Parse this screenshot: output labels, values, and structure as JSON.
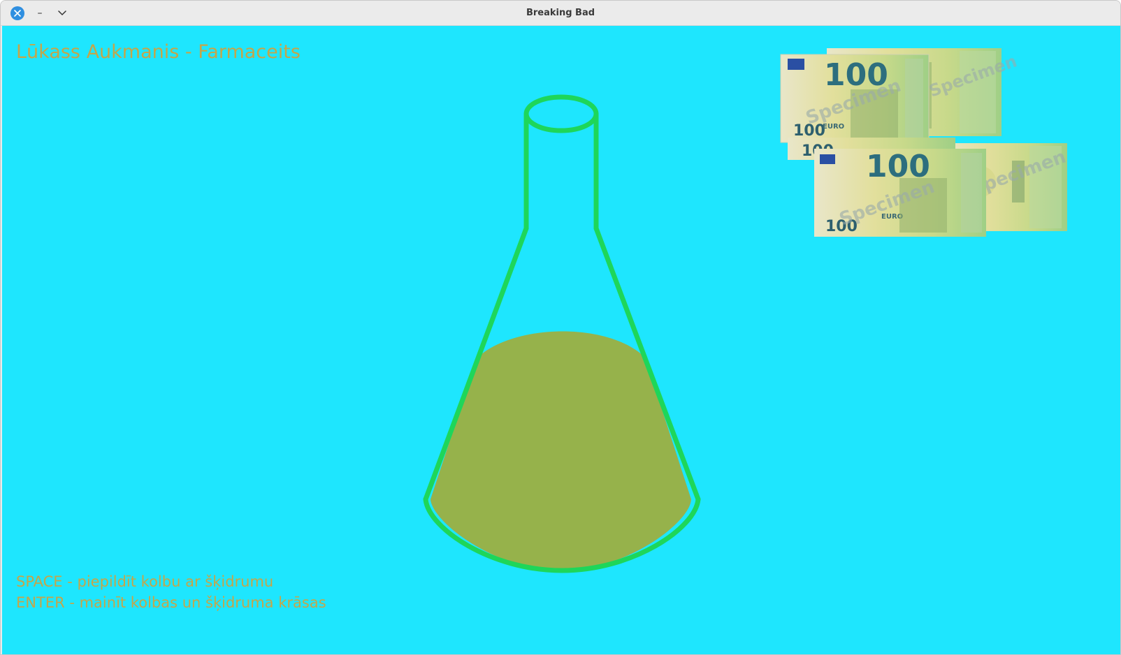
{
  "window": {
    "title": "Breaking Bad",
    "controls": {
      "close_icon": "close-icon",
      "minimize_glyph": "–",
      "menu_glyph": "⌄"
    }
  },
  "game": {
    "heading": "Lūkass Aukmanis - Farmaceits",
    "instructions": [
      "SPACE - piepildīt kolbu ar šķidrumu",
      "ENTER - mainīt kolbas un šķidruma krāsas"
    ],
    "colors": {
      "background": "#1ee6fe",
      "flask_outline": "#1ed65a",
      "liquid": "#96b24b",
      "text": "#c4a64a"
    },
    "liquid_fill_level": 0.5,
    "banknotes": [
      {
        "value": "100",
        "currency": "EURO",
        "watermark": "Specimen"
      },
      {
        "value": "100",
        "currency": "EURO",
        "watermark": "Specimen"
      },
      {
        "value": "100",
        "currency": "EURO",
        "watermark": "Specimen"
      },
      {
        "value": "100",
        "currency": "EURO",
        "watermark": "Specimen"
      }
    ]
  }
}
